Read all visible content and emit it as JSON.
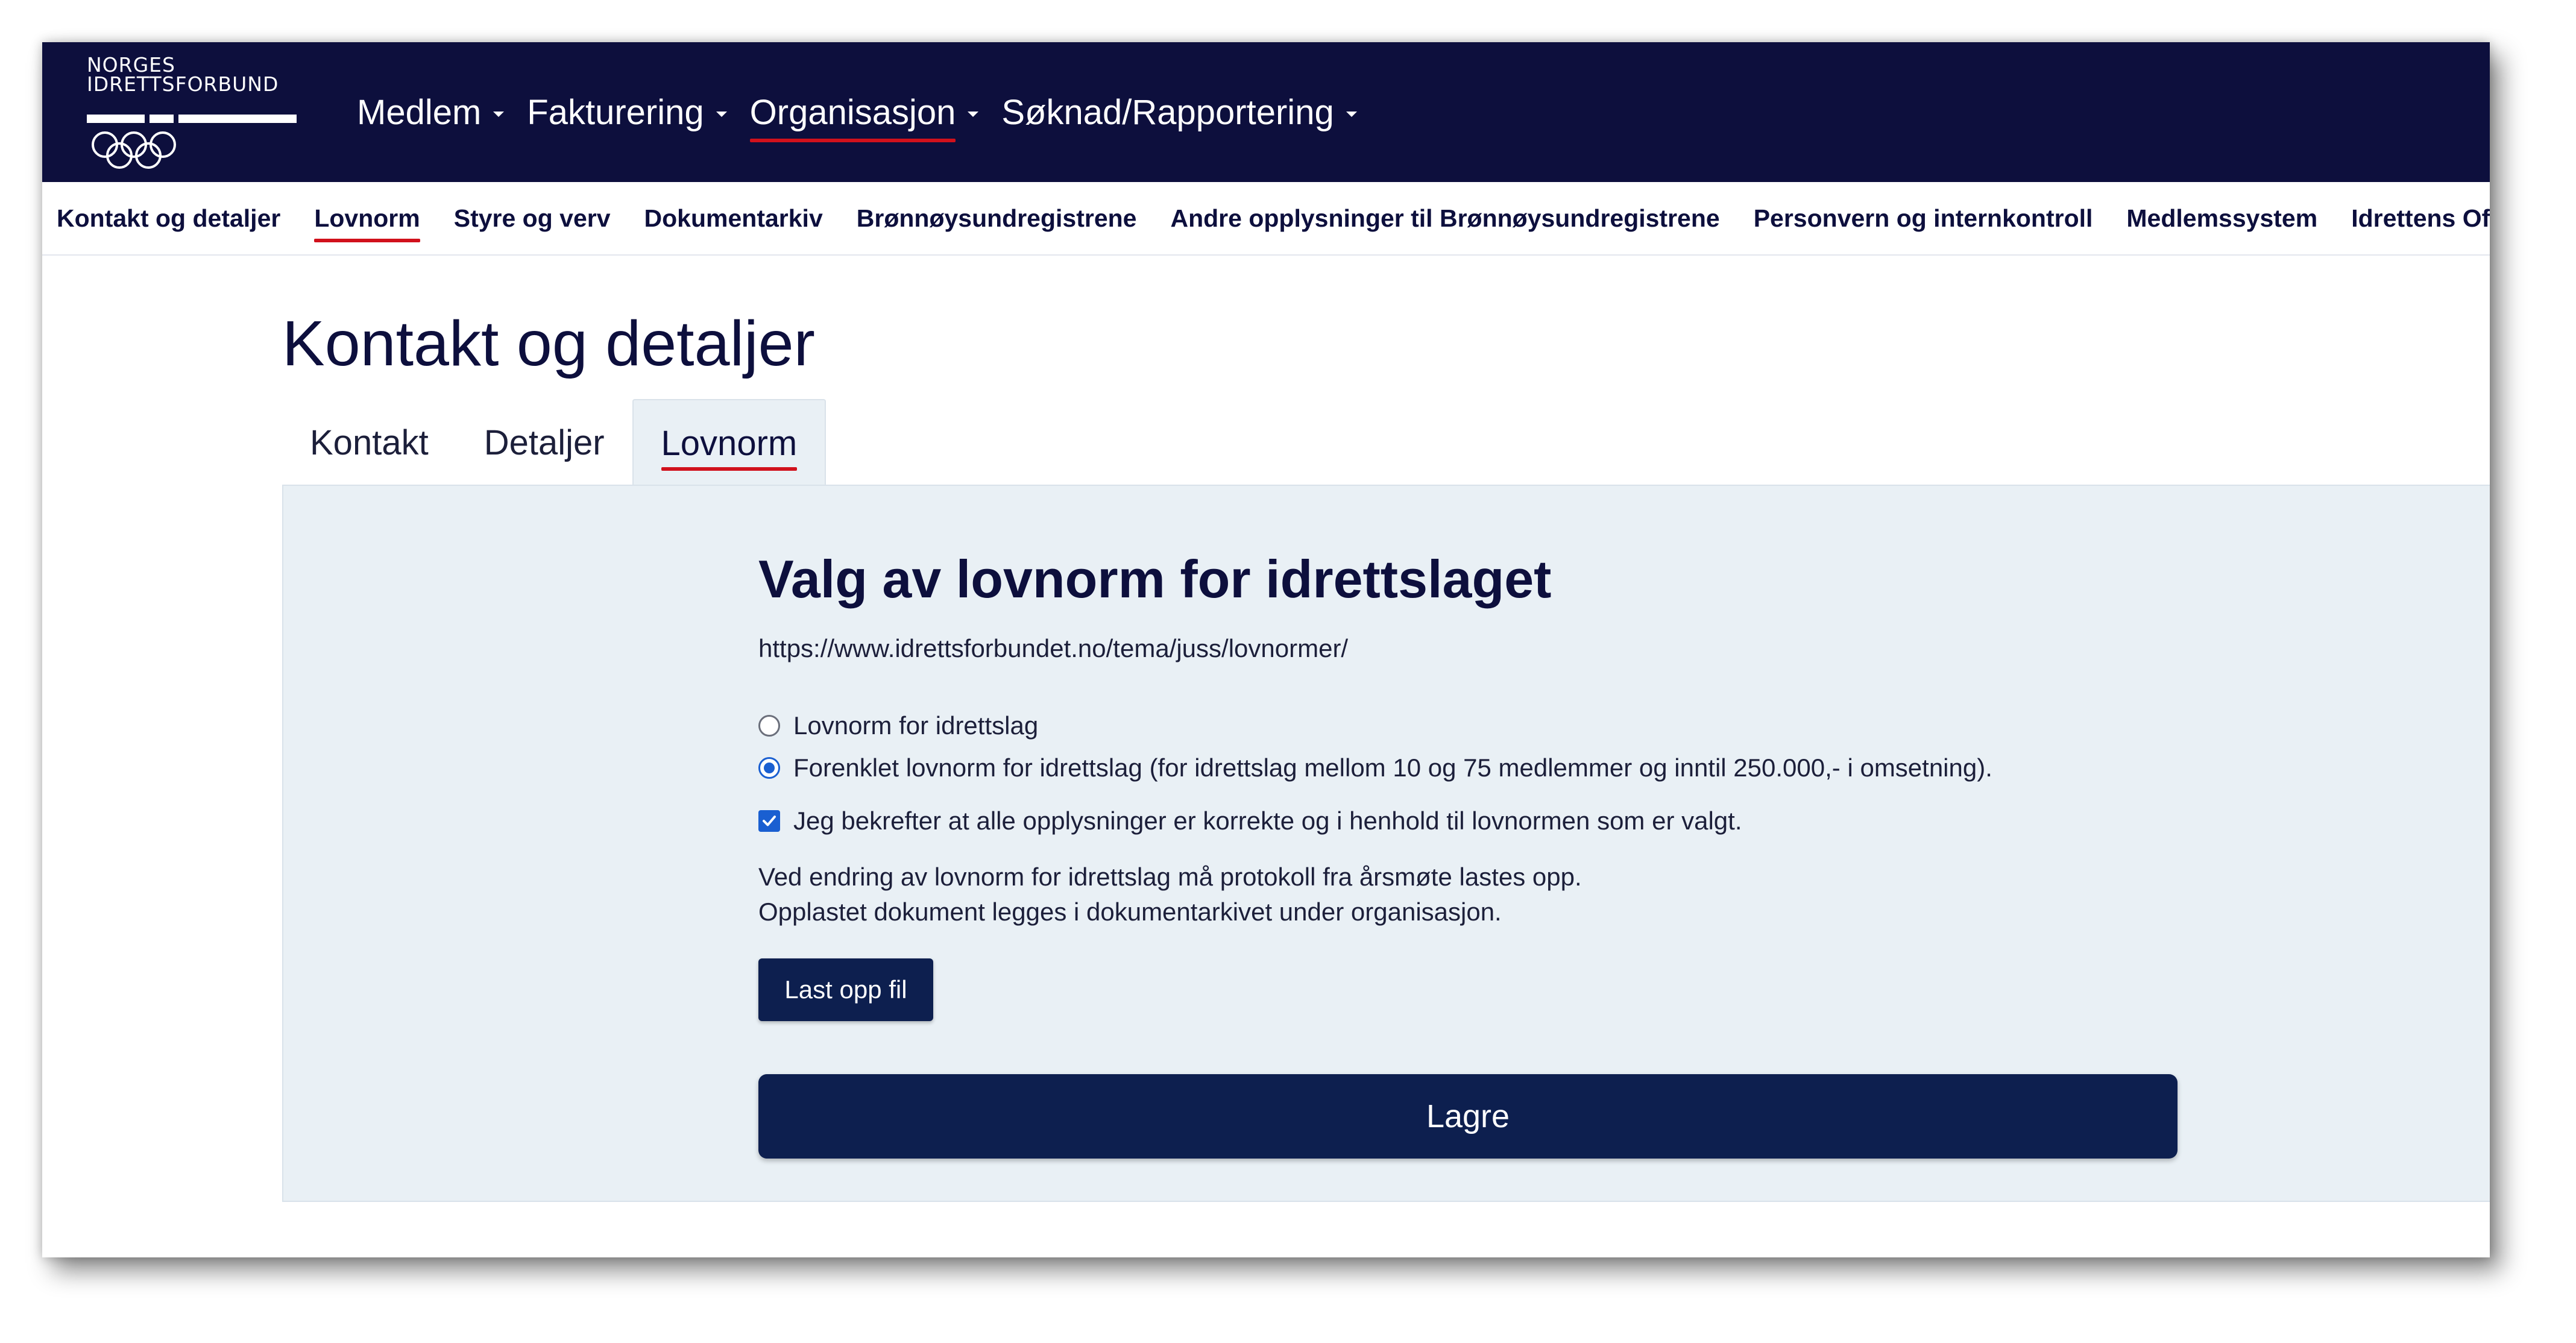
{
  "colors": {
    "navbar_bg": "#0d0f3d",
    "accent_underline": "#d1111c",
    "panel_bg": "#e9f0f5",
    "button_bg": "#0d1f4f",
    "control_blue": "#1a5fd1"
  },
  "logo": {
    "line1": "NORGES",
    "line2": "IDRETTSFORBUND",
    "rings_icon": "olympic-rings-icon"
  },
  "mainnav": {
    "items": [
      {
        "label": "Medlem",
        "active": false
      },
      {
        "label": "Fakturering",
        "active": false
      },
      {
        "label": "Organisasjon",
        "active": true
      },
      {
        "label": "Søknad/Rapportering",
        "active": false
      }
    ],
    "dropdown_icon": "caret-down-icon"
  },
  "subnav": {
    "items": [
      {
        "label": "Kontakt og detaljer",
        "active": false
      },
      {
        "label": "Lovnorm",
        "active": true
      },
      {
        "label": "Styre og verv",
        "active": false
      },
      {
        "label": "Dokumentarkiv",
        "active": false
      },
      {
        "label": "Brønnøysundregistrene",
        "active": false
      },
      {
        "label": "Andre opplysninger til Brønnøysundregistrene",
        "active": false
      },
      {
        "label": "Personvern og internkontroll",
        "active": false
      },
      {
        "label": "Medlemssystem",
        "active": false
      },
      {
        "label": "Idrettens Of",
        "active": false
      }
    ]
  },
  "page": {
    "title": "Kontakt og detaljer",
    "tabs": [
      {
        "label": "Kontakt",
        "active": false
      },
      {
        "label": "Detaljer",
        "active": false
      },
      {
        "label": "Lovnorm",
        "active": true
      }
    ]
  },
  "lovnorm": {
    "heading": "Valg av lovnorm for idrettslaget",
    "link": "https://www.idrettsforbundet.no/tema/juss/lovnormer/",
    "options": [
      {
        "label": "Lovnorm for idrettslag",
        "checked": false
      },
      {
        "label": "Forenklet lovnorm for idrettslag (for idrettslag mellom 10 og 75 medlemmer og inntil 250.000,- i omsetning).",
        "checked": true
      }
    ],
    "confirm": {
      "label": "Jeg bekrefter at alle opplysninger er korrekte og i henhold til lovnormen som er valgt.",
      "checked": true
    },
    "note_line1": "Ved endring av lovnorm for idrettslag må protokoll fra årsmøte lastes opp.",
    "note_line2": "Opplastet dokument legges i dokumentarkivet under organisasjon.",
    "upload_label": "Last opp fil",
    "save_label": "Lagre"
  }
}
